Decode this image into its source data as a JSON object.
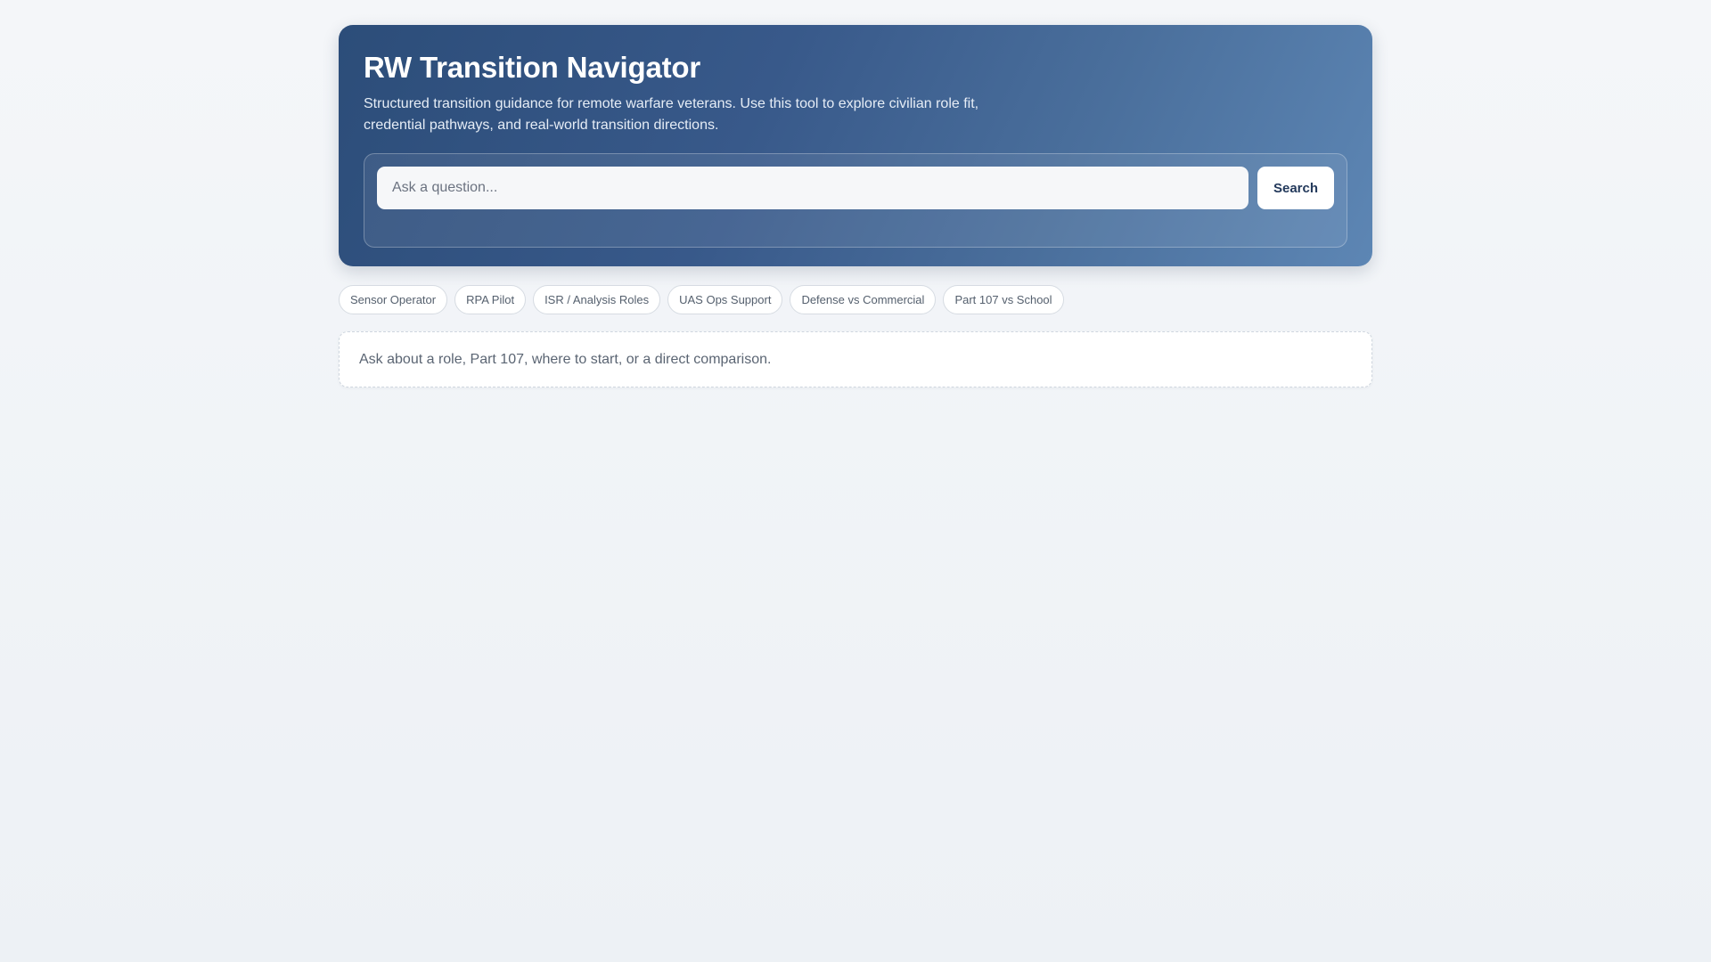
{
  "header": {
    "title": "RW Transition Navigator",
    "subtitle": "Structured transition guidance for remote warfare veterans. Use this tool to explore civilian role fit, credential pathways, and real-world transition directions."
  },
  "search": {
    "placeholder": "Ask a question...",
    "value": "",
    "button_label": "Search"
  },
  "quick_topics": [
    {
      "label": "Sensor Operator"
    },
    {
      "label": "RPA Pilot"
    },
    {
      "label": "ISR / Analysis Roles"
    },
    {
      "label": "UAS Ops Support"
    },
    {
      "label": "Defense vs Commercial"
    },
    {
      "label": "Part 107 vs School"
    }
  ],
  "result": {
    "hint": "Ask about a role, Part 107, where to start, or a direct comparison."
  },
  "colors": {
    "hero_start": "#2c4d79",
    "hero_end": "#5d86b4",
    "button_text": "#23395b",
    "page_bg": "#f1f4f7"
  }
}
